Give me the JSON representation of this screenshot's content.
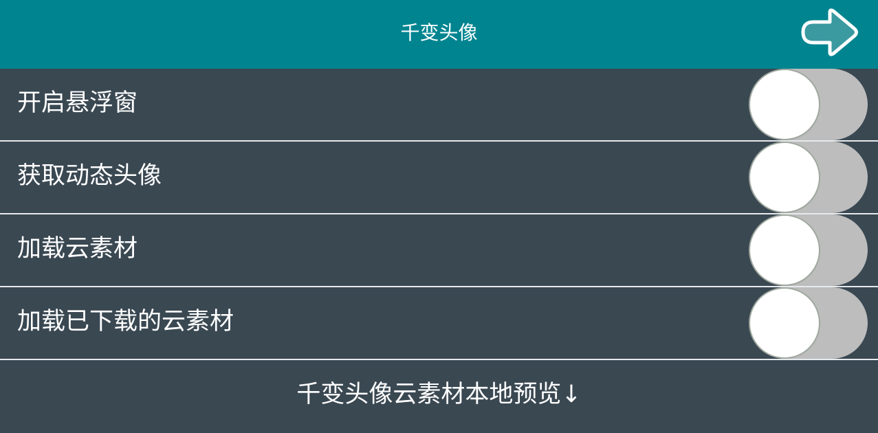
{
  "header": {
    "title": "千变头像",
    "exit_icon": "arrow-right-icon"
  },
  "settings": [
    {
      "label": "开启悬浮窗",
      "enabled": false
    },
    {
      "label": "获取动态头像",
      "enabled": false
    },
    {
      "label": "加载云素材",
      "enabled": false
    },
    {
      "label": "加载已下载的云素材",
      "enabled": false
    }
  ],
  "footer": {
    "preview_label": "千变头像云素材本地预览↓"
  },
  "colors": {
    "header_bg": "#008590",
    "body_bg": "#3a4852",
    "toggle_off": "#bdbdbd",
    "divider": "#e6eaec"
  }
}
